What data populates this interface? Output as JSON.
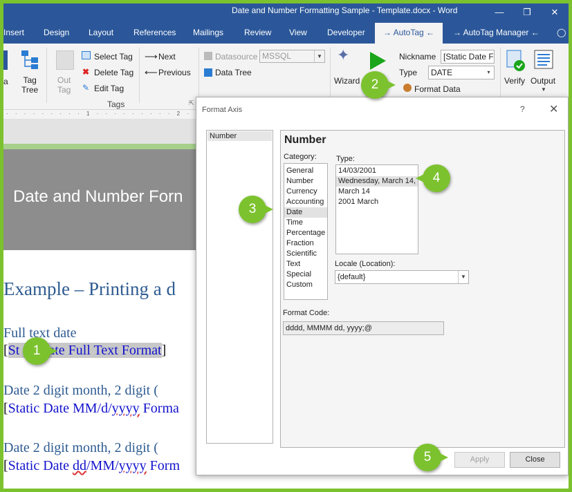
{
  "window": {
    "title": "Date and Number Formatting Sample - Template.docx  -  Word",
    "minimize": "—",
    "restore": "❐",
    "close": "✕"
  },
  "tabs": [
    {
      "label": "Insert"
    },
    {
      "label": "Design"
    },
    {
      "label": "Layout"
    },
    {
      "label": "References"
    },
    {
      "label": "Mailings"
    },
    {
      "label": "Review"
    },
    {
      "label": "View"
    },
    {
      "label": "Developer"
    },
    {
      "label": "→ AutoTag ←"
    },
    {
      "label": "→ AutoTag Manager ←"
    }
  ],
  "ribbon": {
    "tag_label": "Tag\nTree",
    "out_tag": "Out\nTag",
    "select_tag": "Select Tag",
    "delete_tag": "Delete Tag",
    "edit_tag": "Edit Tag",
    "tags_group": "Tags",
    "next": "Next",
    "previous": "Previous",
    "datasource": "Datasource",
    "datasource_value": "MSSQL",
    "data_tree": "Data Tree",
    "wizard": "Wizard",
    "nickname_label": "Nickname",
    "nickname_value": "[Static Date Fu",
    "type_label": "Type",
    "type_value": "DATE",
    "format_data": "Format Data",
    "verify": "Verify",
    "output": "Output"
  },
  "document": {
    "banner": "Date and Number Forn",
    "heading": "Example – Printing a d",
    "h_full": "Full text date",
    "tag_full_prefix": "[",
    "tag_full_hl_a": "St",
    "tag_full_hl_b": "ate Full Text Format",
    "tag_full_suffix": "]",
    "h_mmd": "Date 2 digit month, 2 digit (",
    "tag_mmd_a": "Static Date MM/d/",
    "tag_mmd_b": "yyyy",
    "tag_mmd_c": " Forma",
    "h_ddmm": "Date 2 digit month, 2 digit (",
    "tag_ddmm_a": "Static Date ",
    "tag_ddmm_b": "dd",
    "tag_ddmm_c": "/MM/",
    "tag_ddmm_d": "yyyy",
    "tag_ddmm_e": " Form"
  },
  "dialog": {
    "title": "Format Axis",
    "help": "?",
    "close": "✕",
    "nav_selected": "Number",
    "panel_title": "Number",
    "category_label": "Category:",
    "categories": [
      "General",
      "Number",
      "Currency",
      "Accounting",
      "Date",
      "Time",
      "Percentage",
      "Fraction",
      "Scientific",
      "Text",
      "Special",
      "Custom"
    ],
    "selected_category": "Date",
    "type_label": "Type:",
    "types": [
      "14/03/2001",
      "Wednesday, March 14,",
      "March 14",
      "2001 March"
    ],
    "selected_type": "Wednesday, March 14,",
    "locale_label": "Locale (Location):",
    "locale_value": "{default}",
    "format_code_label": "Format Code:",
    "format_code_value": "dddd, MMMM dd, yyyy;@",
    "apply": "Apply",
    "close_btn": "Close"
  },
  "callouts": [
    "1",
    "2",
    "3",
    "4",
    "5"
  ],
  "colors": {
    "accent_green": "#7cc22e",
    "word_blue": "#2b579a",
    "heading_blue": "#2e5b91",
    "tag_blue": "#1212cc"
  }
}
